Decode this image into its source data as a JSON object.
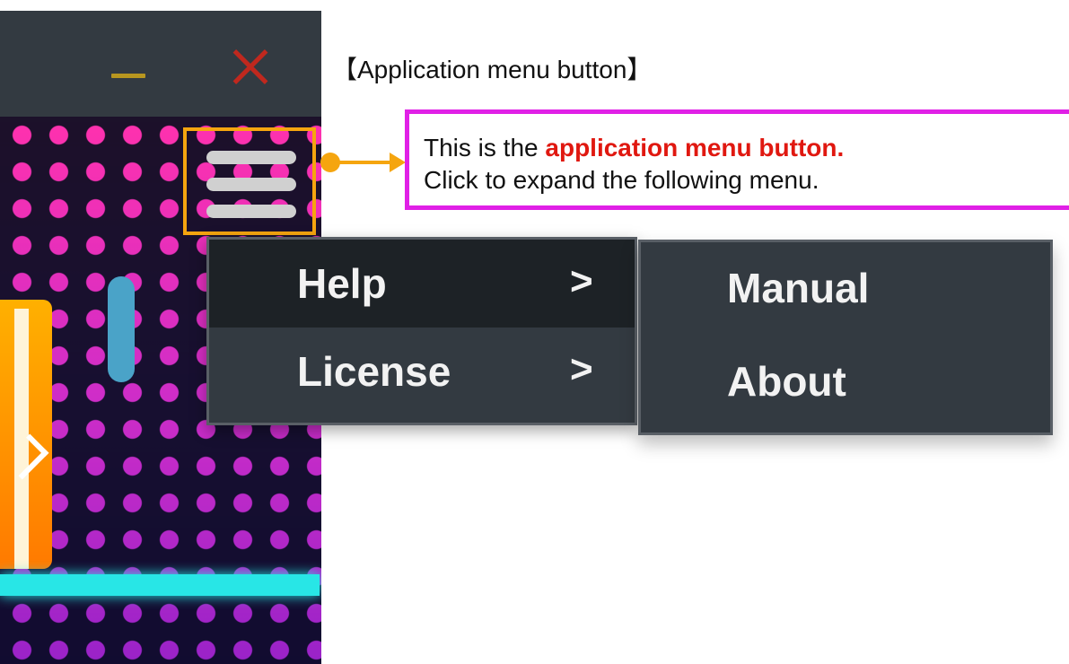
{
  "callout": {
    "title": "【Application menu button】",
    "line1_prefix": "This is the ",
    "line1_highlight": "application menu button.",
    "line2": "Click to expand the following menu."
  },
  "window_controls": {
    "minimize_icon": "minimize-icon",
    "close_icon": "close-icon"
  },
  "menu": {
    "items": [
      {
        "label": "Help",
        "arrow": ">"
      },
      {
        "label": "License",
        "arrow": ">"
      }
    ],
    "submenu": {
      "items": [
        {
          "label": "Manual"
        },
        {
          "label": "About"
        }
      ]
    }
  },
  "colors": {
    "callout_border": "#e020e6",
    "highlight": "#e01810",
    "menu_button_border": "#f5a50f",
    "menu_background": "#333a41",
    "menu_selected": "#1d2226"
  }
}
